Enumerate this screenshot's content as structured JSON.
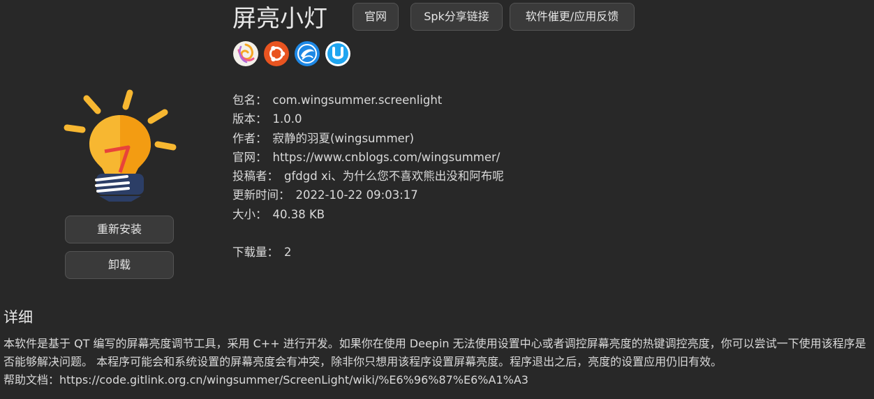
{
  "app": {
    "title": "屏亮小灯",
    "icon": "lightbulb-icon"
  },
  "header_buttons": {
    "website": "官网",
    "spk_share": "Spk分享链接",
    "feedback": "软件催更/应用反馈"
  },
  "distros": [
    {
      "icon": "spark-store-icon"
    },
    {
      "icon": "ubuntu-icon"
    },
    {
      "icon": "deepin-icon"
    },
    {
      "icon": "uos-icon"
    }
  ],
  "meta": {
    "package": {
      "label": "包名：",
      "value": "com.wingsummer.screenlight"
    },
    "version": {
      "label": "版本：",
      "value": "1.0.0"
    },
    "author": {
      "label": "作者：",
      "value": "寂静的羽夏(wingsummer)"
    },
    "website": {
      "label": "官网：",
      "value": "https://www.cnblogs.com/wingsummer/"
    },
    "contributor": {
      "label": "投稿者：",
      "value": "gfdgd xi、为什么您不喜欢熊出没和阿布呢"
    },
    "updated": {
      "label": "更新时间：",
      "value": "2022-10-22 09:03:17"
    },
    "size": {
      "label": "大小：",
      "value": "40.38 KB"
    },
    "downloads": {
      "label": "下载量：",
      "value": "2"
    }
  },
  "actions": {
    "reinstall": "重新安装",
    "uninstall": "卸载"
  },
  "details": {
    "heading": "详细",
    "paragraph": "本软件是基于 QT 编写的屏幕亮度调节工具，采用 C++ 进行开发。如果你在使用 Deepin 无法使用设置中心或者调控屏幕亮度的热键调控亮度，你可以尝试一下使用该程序是否能够解决问题。 本程序可能会和系统设置的屏幕亮度会有冲突，除非你只想用该程序设置屏幕亮度。程序退出之后，亮度的设置应用仍旧有效。",
    "help": "帮助文档：https://code.gitlink.org.cn/wingsummer/ScreenLight/wiki/%E6%96%87%E6%A1%A3"
  },
  "colors": {
    "background": "#282828",
    "button_bg": "#3a3a3a",
    "bulb_yellow": "#f7b731",
    "bulb_orange": "#f39c12",
    "ubuntu_orange": "#e95420",
    "deepin_blue": "#1e88e5"
  }
}
